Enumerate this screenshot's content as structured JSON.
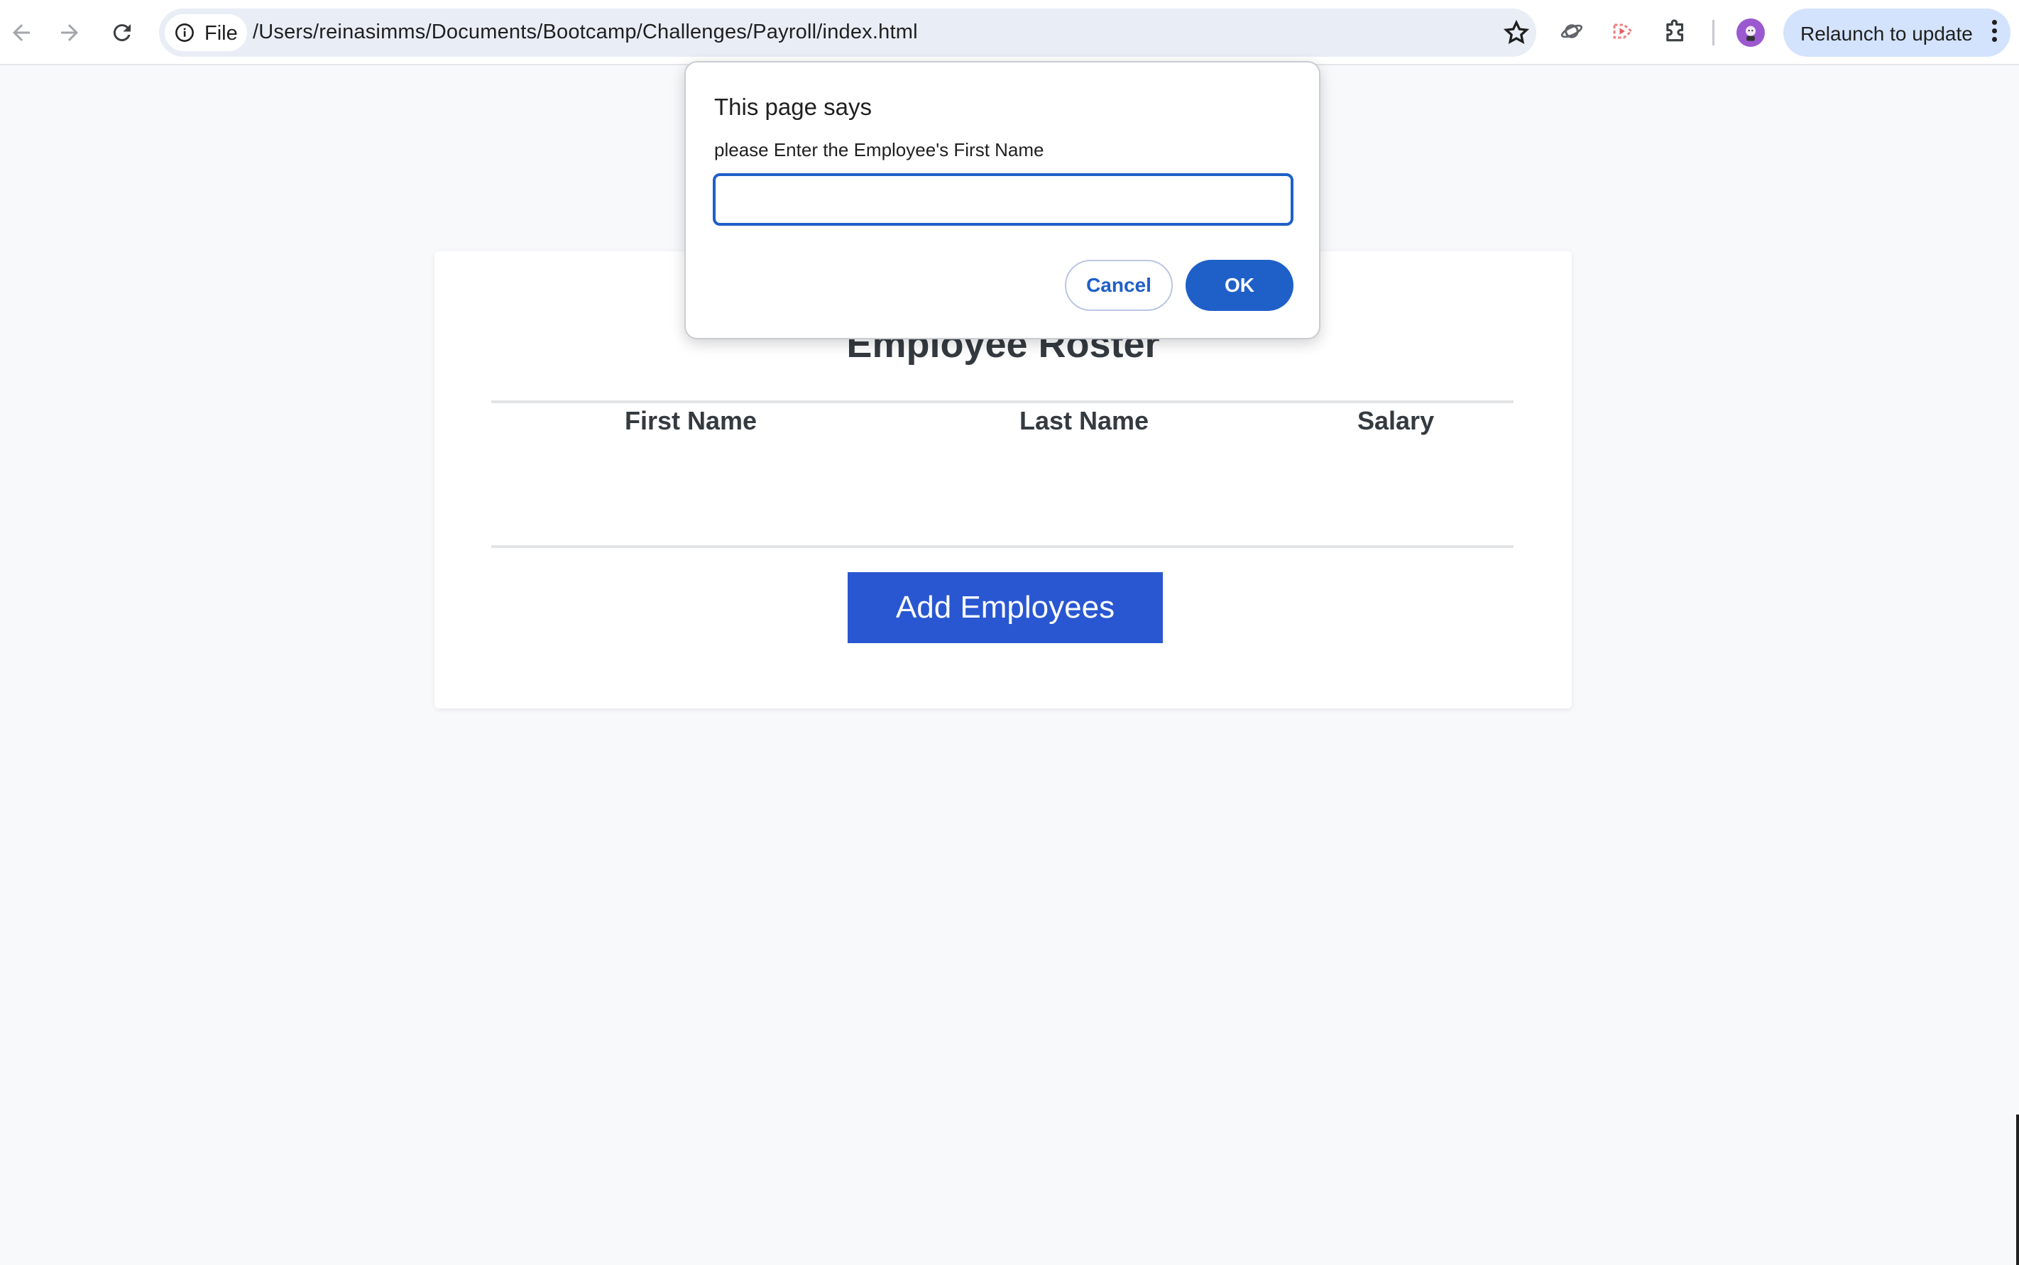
{
  "browser": {
    "file_chip_label": "File",
    "url": "/Users/reinasimms/Documents/Bootcamp/Challenges/Payroll/index.html",
    "relaunch_label": "Relaunch to update",
    "avatar_color": "#9b59d0"
  },
  "page": {
    "title": "Employee Roster",
    "columns": [
      "First Name",
      "Last Name",
      "Salary"
    ],
    "rows": [],
    "add_button_label": "Add Employees",
    "accent_color": "#2957d1"
  },
  "dialog": {
    "title": "This page says",
    "message": "please Enter the Employee's First Name",
    "input_value": "",
    "cancel_label": "Cancel",
    "ok_label": "OK"
  }
}
